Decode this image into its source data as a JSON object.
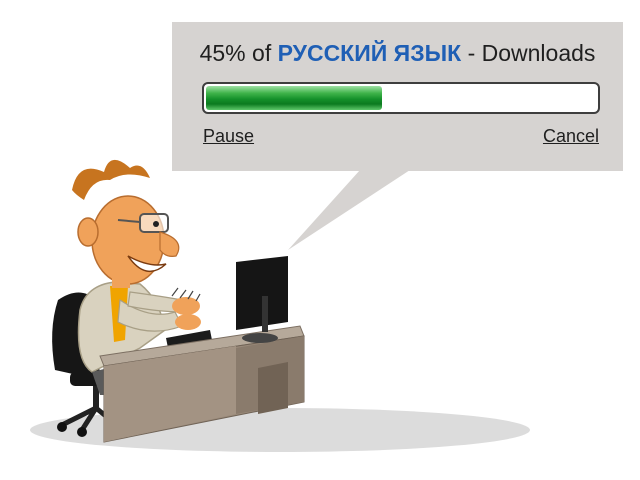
{
  "download": {
    "progress_text": "45%",
    "of_text": "of",
    "item_name": "РУССКИЙ ЯЗЫК",
    "suffix_text": "- Downloads",
    "progress": 0.45,
    "pause_label": "Pause",
    "cancel_label": "Cancel"
  },
  "colors": {
    "dialog_background": "#d6d3d1",
    "item_name": "#1f5fb5",
    "progress_fill": "#14902a"
  },
  "illustration": {
    "subject": "cartoon man with glasses typing at a computer desk"
  }
}
